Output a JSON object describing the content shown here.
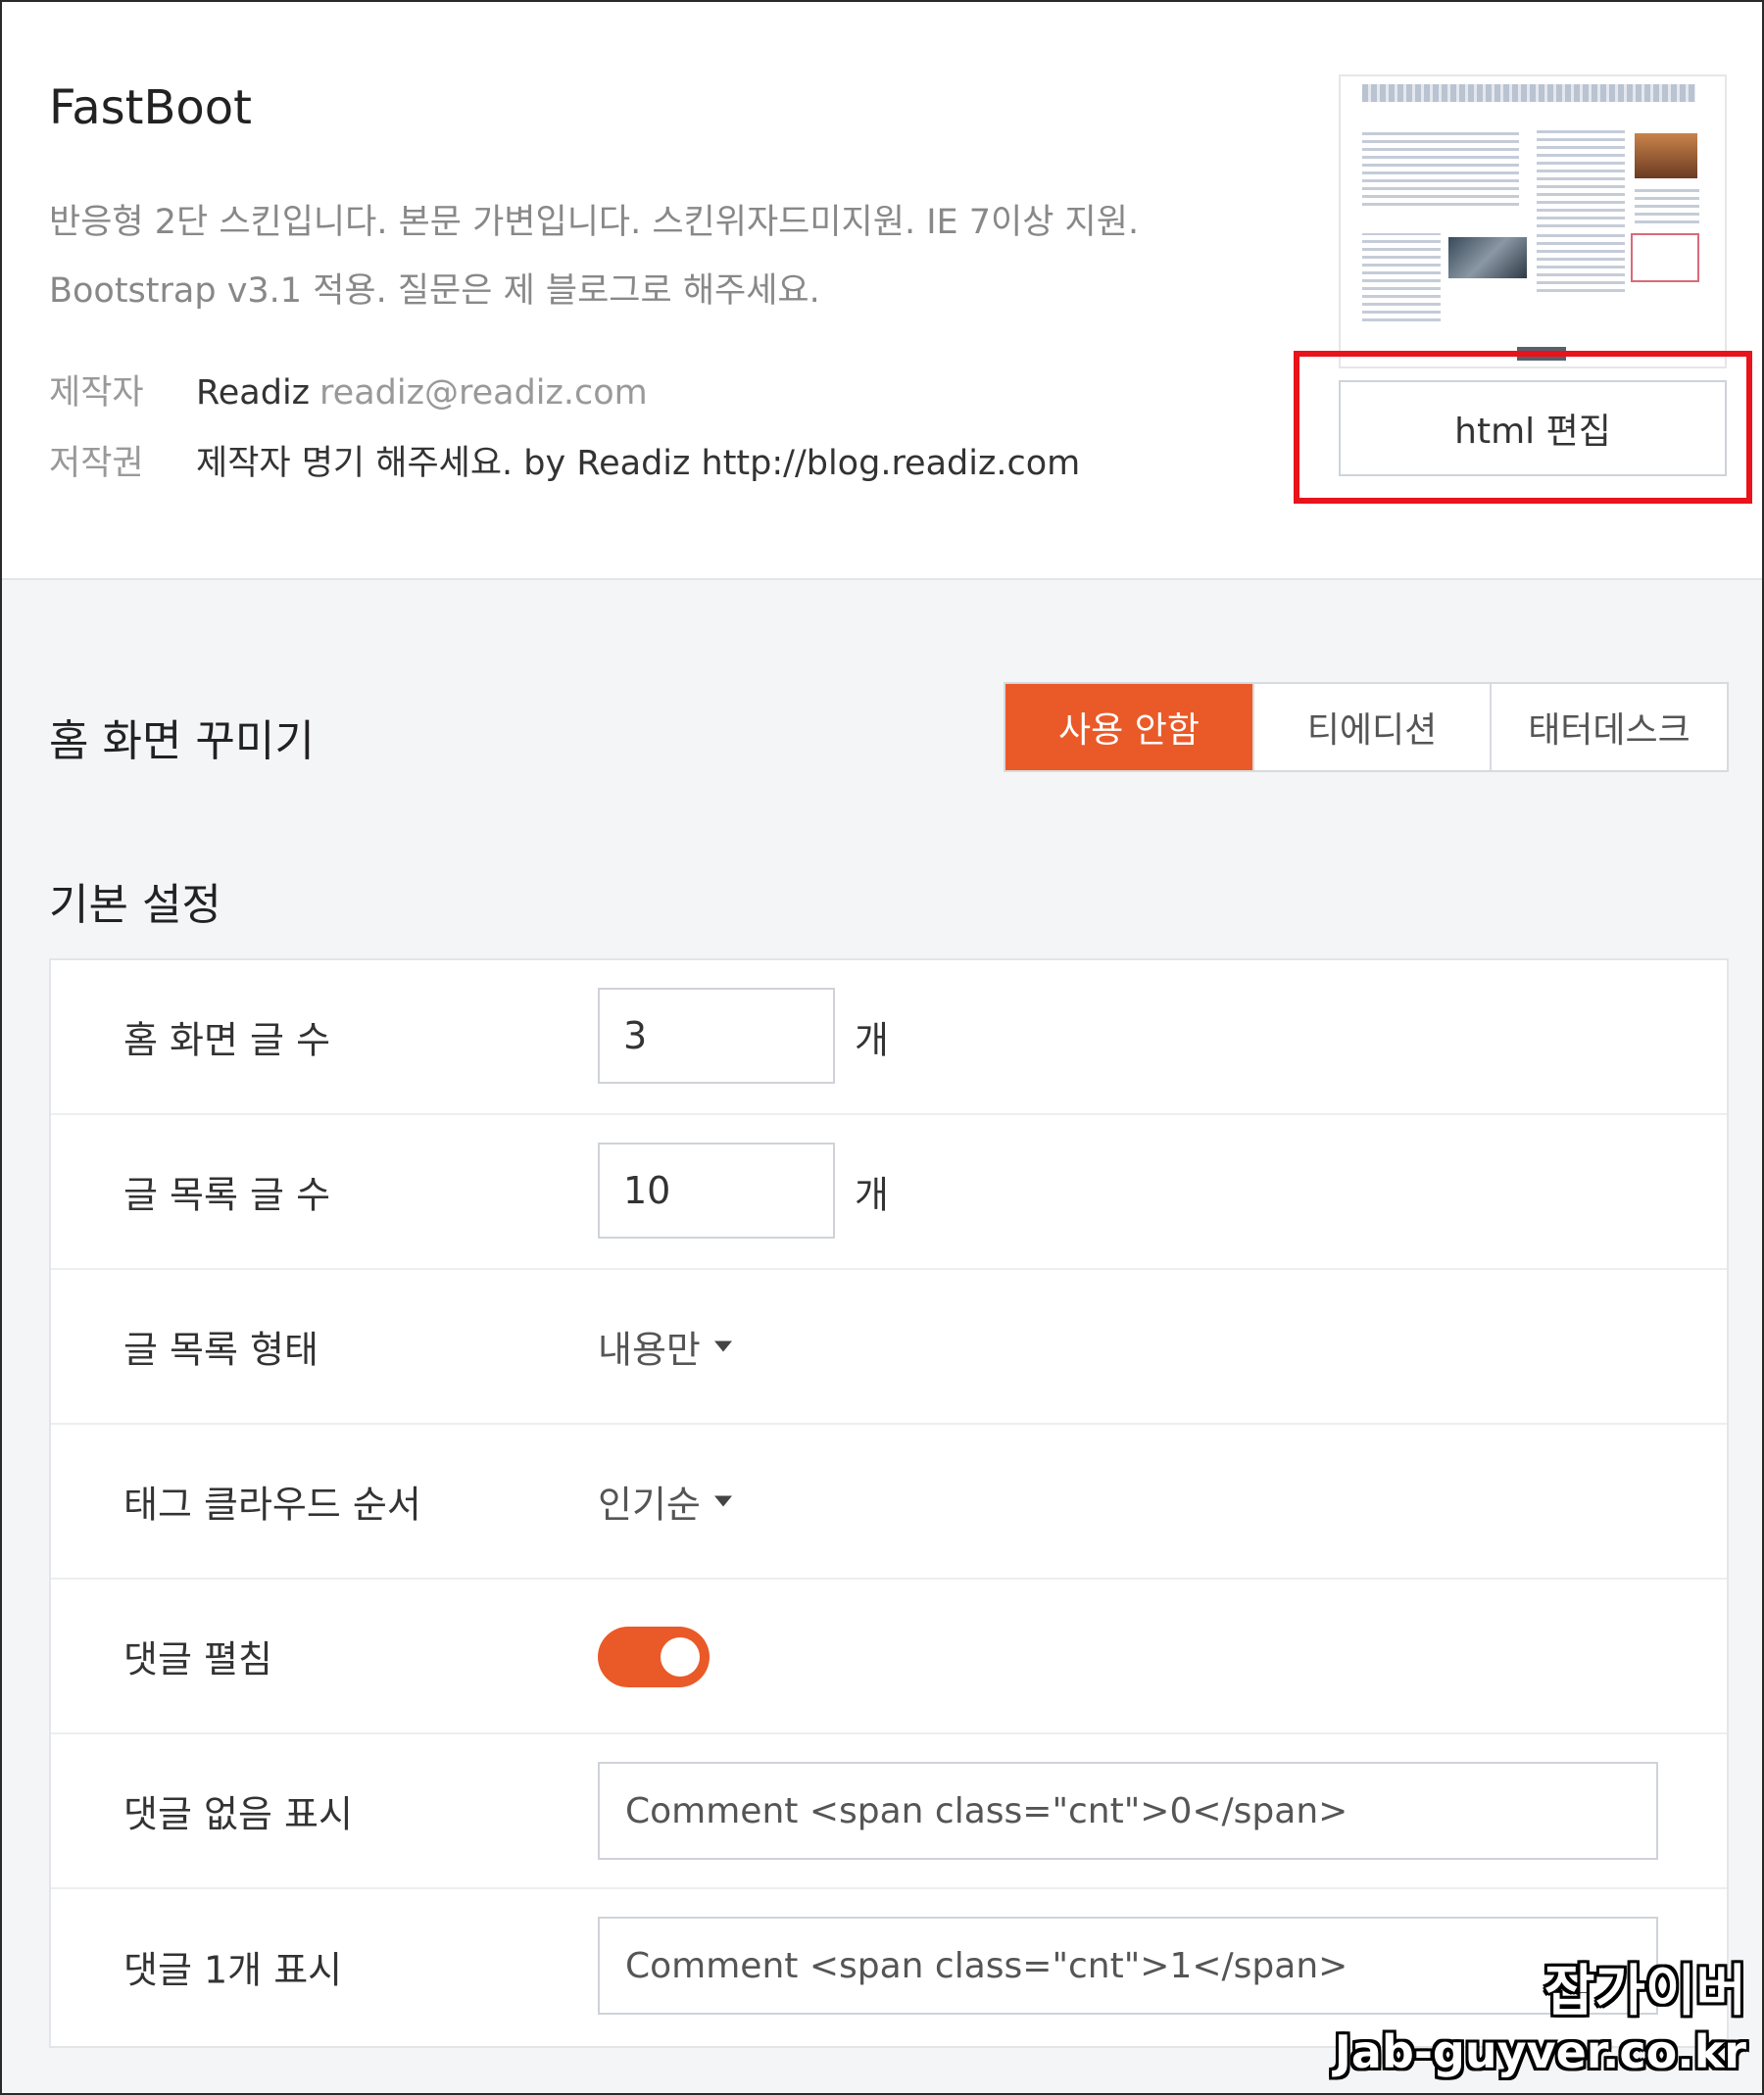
{
  "skin": {
    "title": "FastBoot",
    "description_line1": "반응형 2단 스킨입니다. 본문 가변입니다. 스킨위자드미지원. IE 7이상 지원.",
    "description_line2": "Bootstrap v3.1 적용. 질문은 제 블로그로 해주세요.",
    "author_label": "제작자",
    "author_name": "Readiz",
    "author_email": "readiz@readiz.com",
    "copyright_label": "저작권",
    "copyright_value": "제작자 명기 해주세요. by Readiz http://blog.readiz.com",
    "html_edit_label": "html 편집"
  },
  "home_decorate": {
    "title": "홈 화면 꾸미기",
    "options": [
      "사용 안함",
      "티에디션",
      "태터데스크"
    ],
    "selected_index": 0
  },
  "basic_settings": {
    "title": "기본 설정",
    "home_post_count": {
      "label": "홈 화면 글 수",
      "value": "3",
      "unit": "개"
    },
    "list_post_count": {
      "label": "글 목록 글 수",
      "value": "10",
      "unit": "개"
    },
    "list_type": {
      "label": "글 목록 형태",
      "selected": "내용만"
    },
    "tag_cloud_order": {
      "label": "태그 클라우드 순서",
      "selected": "인기순"
    },
    "comment_expand": {
      "label": "댓글 펼침",
      "enabled": true
    },
    "no_comment_display": {
      "label": "댓글 없음 표시",
      "value": "Comment <span class=\"cnt\">0</span>"
    },
    "one_comment_display": {
      "label": "댓글 1개 표시",
      "value": "Comment <span class=\"cnt\">1</span>"
    }
  },
  "colors": {
    "accent": "#ea5a28",
    "highlight": "#e8131b"
  },
  "icons": {
    "dropdown": "caret-down-icon"
  },
  "watermark": {
    "korean": "잡가이버",
    "domain": "Jab-guyver.co.kr"
  }
}
